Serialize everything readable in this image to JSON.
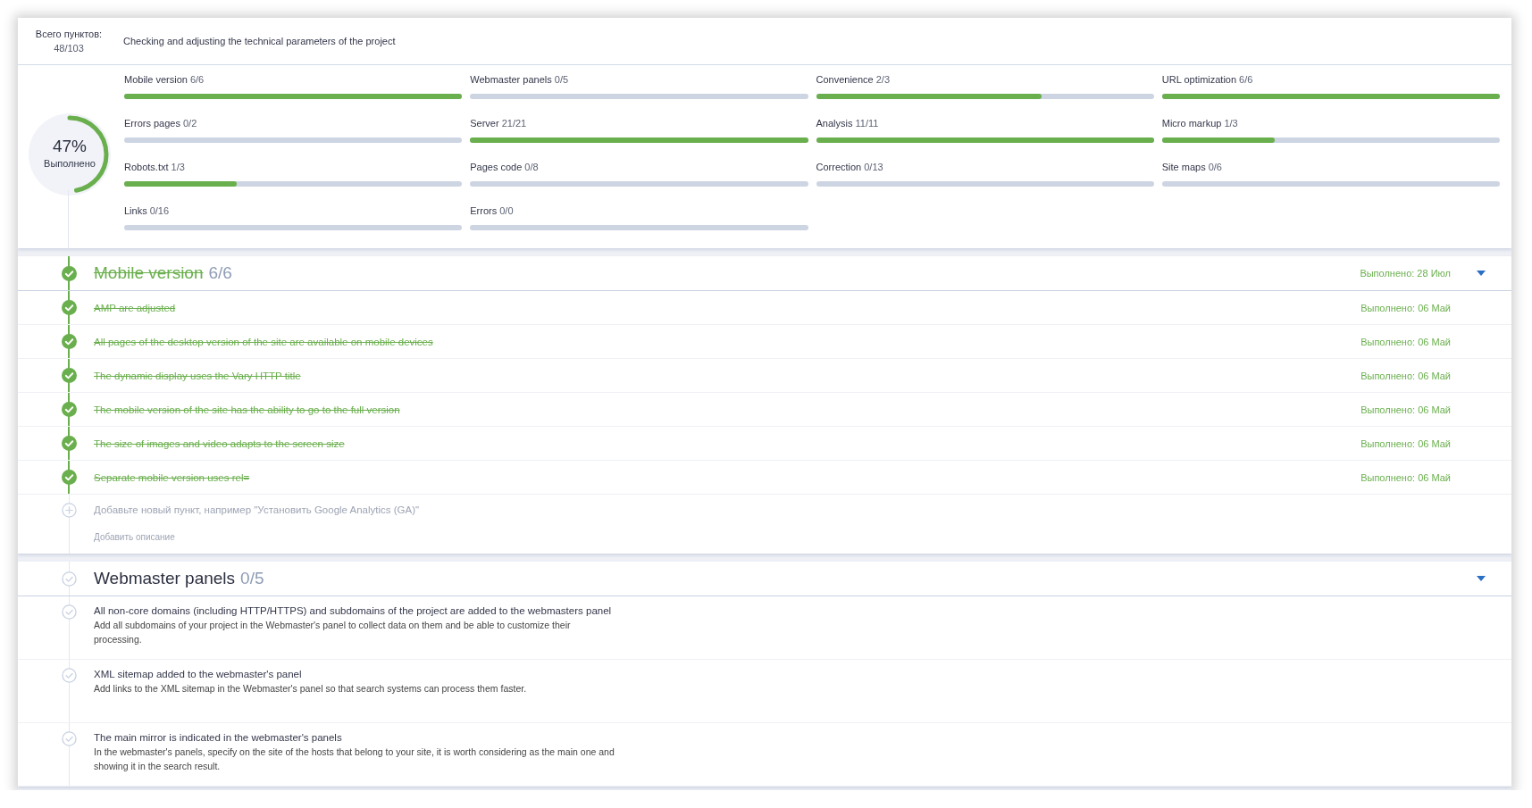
{
  "summary": {
    "label": "Всего пунктов:",
    "value": "48/103"
  },
  "project_title": "Checking and adjusting the technical parameters of the project",
  "overall": {
    "percent": "47%",
    "caption": "Выполнено",
    "level": 0.47
  },
  "categories": [
    {
      "name": "Mobile version",
      "count": "6/6",
      "level": 1
    },
    {
      "name": "Webmaster panels",
      "count": "0/5",
      "level": 0
    },
    {
      "name": "Convenience",
      "count": "2/3",
      "level": 0.667
    },
    {
      "name": "URL optimization",
      "count": "6/6",
      "level": 1
    },
    {
      "name": "Errors pages",
      "count": "0/2",
      "level": 0
    },
    {
      "name": "Server",
      "count": "21/21",
      "level": 1
    },
    {
      "name": "Analysis",
      "count": "11/11",
      "level": 1
    },
    {
      "name": "Micro markup",
      "count": "1/3",
      "level": 0.333
    },
    {
      "name": "Robots.txt",
      "count": "1/3",
      "level": 0.333
    },
    {
      "name": "Pages code",
      "count": "0/8",
      "level": 0
    },
    {
      "name": "Correction",
      "count": "0/13",
      "level": 0
    },
    {
      "name": "Site maps",
      "count": "0/6",
      "level": 0
    },
    {
      "name": "Links",
      "count": "0/16",
      "level": 0
    },
    {
      "name": "Errors",
      "count": "0/0",
      "level": 0
    }
  ],
  "sections": [
    {
      "title": "Mobile version",
      "count": "6/6",
      "done": true,
      "date": "Выполнено: 28 Июл",
      "expanded": true,
      "items": [
        {
          "text": "AMP are adjusted",
          "done": true,
          "date": "Выполнено: 06 Май"
        },
        {
          "text": "All pages of the desktop version of the site are available on mobile devices",
          "done": true,
          "date": "Выполнено: 06 Май"
        },
        {
          "text": "The dynamic display uses the Vary HTTP title",
          "done": true,
          "date": "Выполнено: 06 Май"
        },
        {
          "text": "The mobile version of the site has the ability to go to the full version",
          "done": true,
          "date": "Выполнено: 06 Май"
        },
        {
          "text": "The size of images and video adapts to the screen size",
          "done": true,
          "date": "Выполнено: 06 Май"
        },
        {
          "text": "Separate mobile version uses rel=",
          "done": true,
          "date": "Выполнено: 06 Май"
        }
      ],
      "new_item": {
        "placeholder": "Добавьте новый пункт, например \"Установить Google Analytics (GA)\"",
        "description_placeholder": "Добавить описание"
      }
    },
    {
      "title": "Webmaster panels",
      "count": "0/5",
      "done": false,
      "expanded": true,
      "items": [
        {
          "text": "All non-core domains (including HTTP/HTTPS) and subdomains of the project are added to the webmasters panel",
          "done": false,
          "description": "Add all subdomains of your project in the Webmaster's panel to collect data on them and be able to customize their processing."
        },
        {
          "text": "XML sitemap added to the webmaster's panel",
          "done": false,
          "description": "Add links to the XML sitemap in the Webmaster's panel so that search systems can process them faster."
        },
        {
          "text": "The main mirror is indicated in the webmaster's panels",
          "done": false,
          "description": "In the webmaster's panels, specify on the site of the hosts that belong to your site, it is worth considering as the main one and showing it in the search result."
        }
      ]
    }
  ]
}
